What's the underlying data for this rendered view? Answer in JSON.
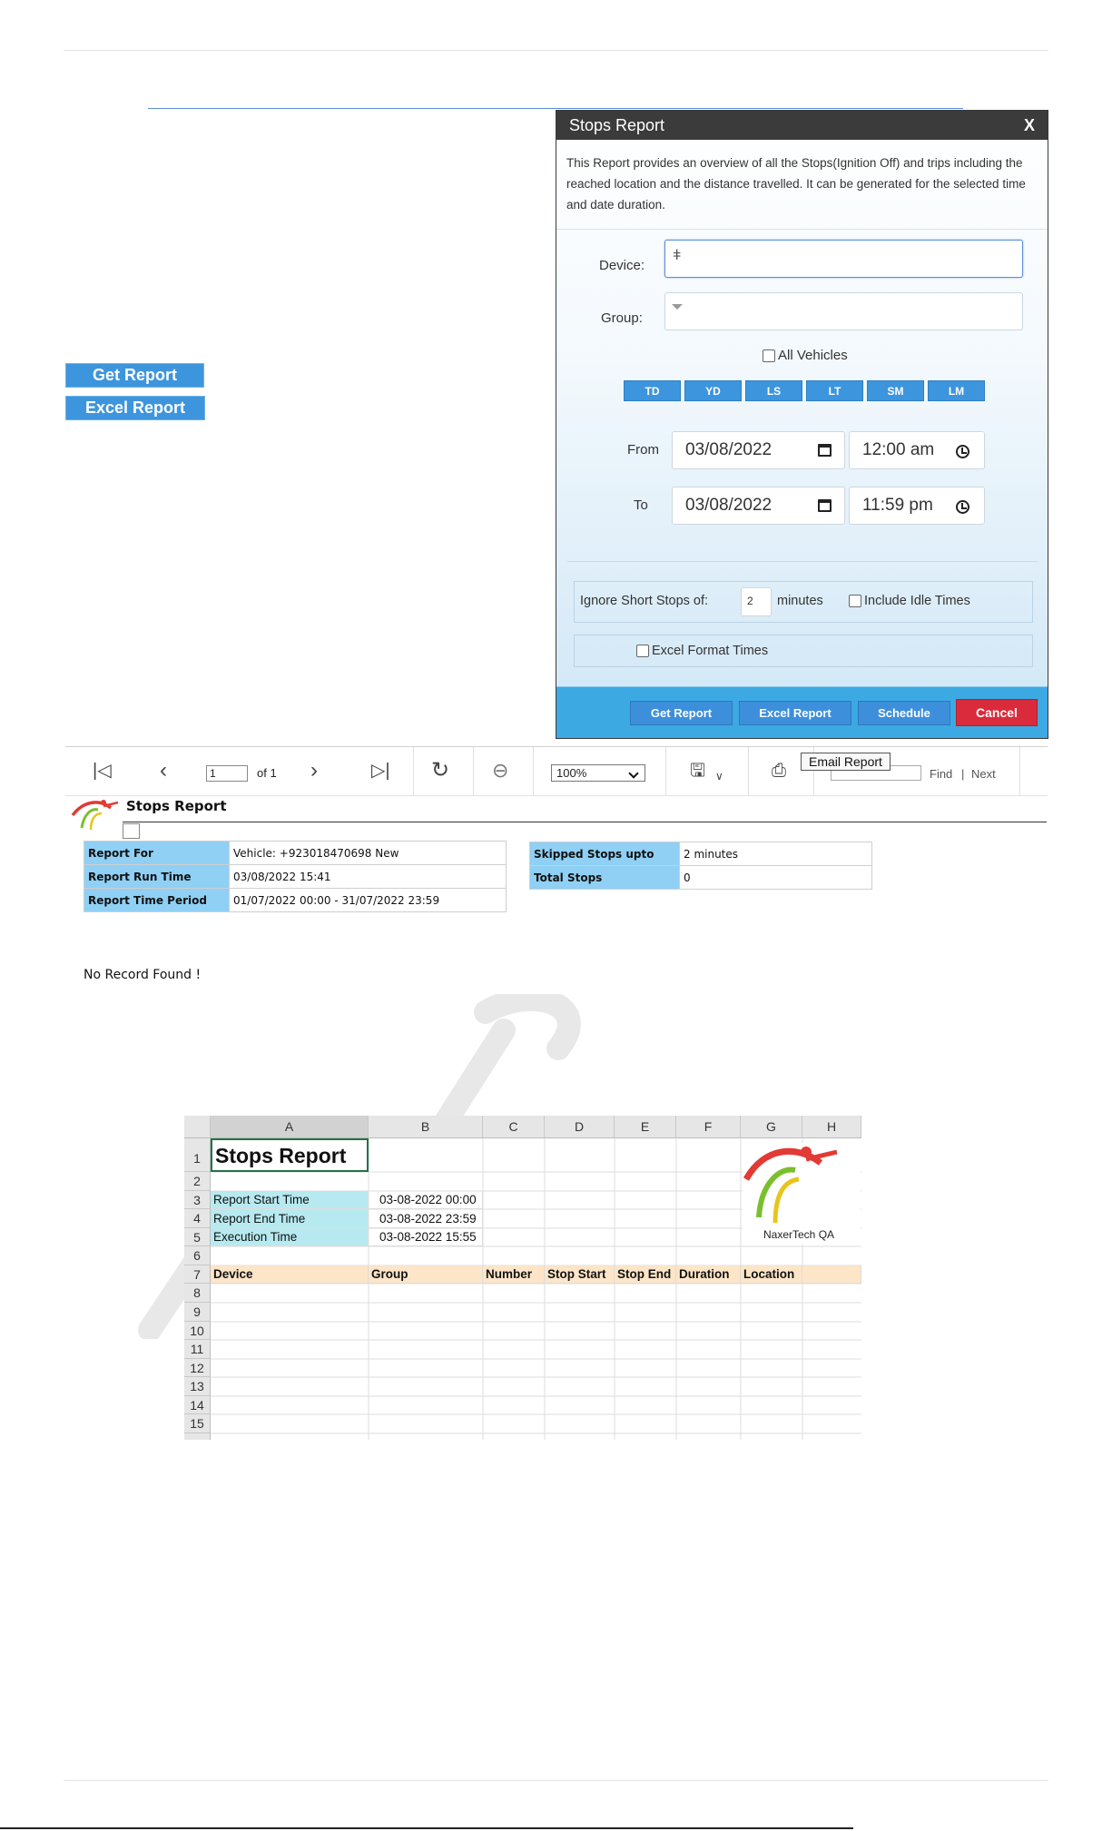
{
  "side_buttons": {
    "get_report": "Get Report",
    "excel_report": "Excel Report"
  },
  "modal": {
    "title": "Stops Report",
    "close": "X",
    "description": "This Report provides an overview of all the Stops(Ignition Off) and trips including the reached location and the distance travelled. It can be generated for the selected time and date duration.",
    "device_label": "Device:",
    "group_label": "Group:",
    "all_vehicles": "All Vehicles",
    "quick_buttons": [
      "TD",
      "YD",
      "LS",
      "LT",
      "SM",
      "LM"
    ],
    "from_label": "From",
    "to_label": "To",
    "from_date": "03/08/2022",
    "from_time": "12:00 am",
    "to_date": "03/08/2022",
    "to_time": "11:59 pm",
    "ignore_label": "Ignore Short Stops of:",
    "ignore_value": "2",
    "minutes_label": "minutes",
    "include_idle": "Include Idle Times",
    "excel_format": "Excel Format Times",
    "footer": {
      "get_report": "Get Report",
      "excel_report": "Excel Report",
      "schedule": "Schedule",
      "cancel": "Cancel"
    }
  },
  "viewer": {
    "page_value": "1",
    "page_of": "of 1",
    "zoom": "100%",
    "tooltip": "Email Report",
    "find": "Find",
    "separator": "|",
    "next": "Next"
  },
  "report": {
    "title": "Stops Report",
    "left_table": [
      {
        "label": "Report For",
        "value": "Vehicle: +923018470698 New"
      },
      {
        "label": "Report Run Time",
        "value": "03/08/2022 15:41"
      },
      {
        "label": "Report Time Period",
        "value": "01/07/2022 00:00 - 31/07/2022 23:59"
      }
    ],
    "right_table": [
      {
        "label": "Skipped Stops upto",
        "value": "2 minutes"
      },
      {
        "label": "Total Stops",
        "value": "0"
      }
    ],
    "no_record": "No Record Found !"
  },
  "excel": {
    "columns": [
      "A",
      "B",
      "C",
      "D",
      "E",
      "F",
      "G",
      "H"
    ],
    "rows": [
      "1",
      "2",
      "3",
      "4",
      "5",
      "6",
      "7",
      "8",
      "9",
      "10",
      "11",
      "12",
      "13",
      "14",
      "15"
    ],
    "title": "Stops Report",
    "meta": [
      {
        "label": "Report Start Time",
        "value": "03-08-2022 00:00"
      },
      {
        "label": "Report End Time",
        "value": "03-08-2022 23:59"
      },
      {
        "label": "Execution Time",
        "value": "03-08-2022 15:55"
      }
    ],
    "headers": [
      "Device",
      "Group",
      "Number",
      "Stop Start",
      "Stop End",
      "Duration",
      "Location"
    ],
    "logo_text": "NaxerTech QA",
    "colors": {
      "meta_fill": "#b7eaf0",
      "header_fill": "#fde5c8",
      "logo_red": "#e23a34",
      "logo_green": "#7bbf2e",
      "logo_yellow": "#e8c51d"
    }
  }
}
